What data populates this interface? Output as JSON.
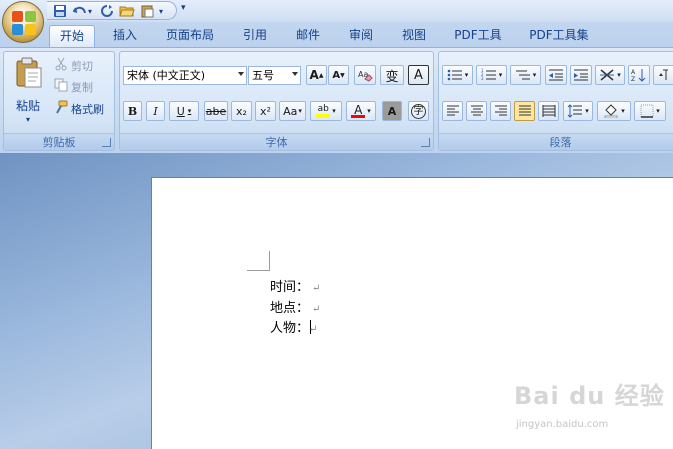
{
  "qat": {
    "customize_arrow": "▾"
  },
  "tabs": [
    {
      "label": "开始",
      "active": true
    },
    {
      "label": "插入"
    },
    {
      "label": "页面布局"
    },
    {
      "label": "引用"
    },
    {
      "label": "邮件"
    },
    {
      "label": "审阅"
    },
    {
      "label": "视图"
    },
    {
      "label": "PDF工具"
    },
    {
      "label": "PDF工具集"
    }
  ],
  "clipboard": {
    "paste_label": "粘贴",
    "cut_label": "剪切",
    "copy_label": "复制",
    "format_painter_label": "格式刷",
    "group_label": "剪贴板"
  },
  "font": {
    "font_name": "宋体 (中文正文)",
    "font_size": "五号",
    "group_label": "字体",
    "bold": "B",
    "italic": "I",
    "underline": "U",
    "strike": "abe",
    "subscript": "x₂",
    "superscript": "x²",
    "change_case": "Aa",
    "grow": "A",
    "shrink": "A",
    "font_color_letter": "A",
    "char_shading": "A",
    "enclose": "字",
    "phonetic": "变",
    "char_border": "A",
    "highlight": "ab",
    "highlight_color": "#ffff00",
    "font_color": "#ff0000"
  },
  "paragraph": {
    "group_label": "段落",
    "shading_color": "#ffe7a0"
  },
  "document": {
    "lines": [
      {
        "text": "时间："
      },
      {
        "text": "地点："
      },
      {
        "text": "人物："
      }
    ],
    "paragraph_mark": "↵"
  },
  "watermark": {
    "brand": "Bai du 经验",
    "url": "jingyan.baidu.com"
  }
}
